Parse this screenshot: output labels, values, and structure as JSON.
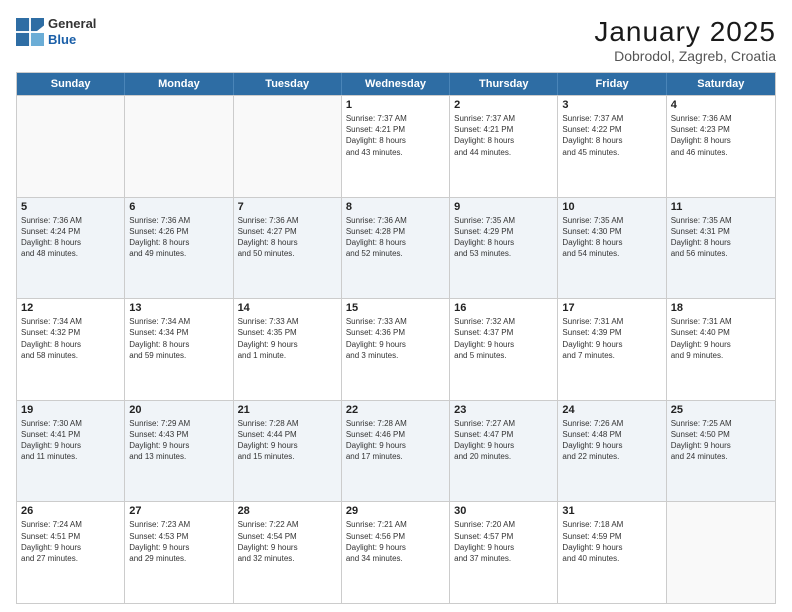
{
  "header": {
    "logo_general": "General",
    "logo_blue": "Blue",
    "title": "January 2025",
    "subtitle": "Dobrodol, Zagreb, Croatia"
  },
  "weekdays": [
    "Sunday",
    "Monday",
    "Tuesday",
    "Wednesday",
    "Thursday",
    "Friday",
    "Saturday"
  ],
  "weeks": [
    [
      {
        "day": "",
        "info": ""
      },
      {
        "day": "",
        "info": ""
      },
      {
        "day": "",
        "info": ""
      },
      {
        "day": "1",
        "info": "Sunrise: 7:37 AM\nSunset: 4:21 PM\nDaylight: 8 hours\nand 43 minutes."
      },
      {
        "day": "2",
        "info": "Sunrise: 7:37 AM\nSunset: 4:21 PM\nDaylight: 8 hours\nand 44 minutes."
      },
      {
        "day": "3",
        "info": "Sunrise: 7:37 AM\nSunset: 4:22 PM\nDaylight: 8 hours\nand 45 minutes."
      },
      {
        "day": "4",
        "info": "Sunrise: 7:36 AM\nSunset: 4:23 PM\nDaylight: 8 hours\nand 46 minutes."
      }
    ],
    [
      {
        "day": "5",
        "info": "Sunrise: 7:36 AM\nSunset: 4:24 PM\nDaylight: 8 hours\nand 48 minutes."
      },
      {
        "day": "6",
        "info": "Sunrise: 7:36 AM\nSunset: 4:26 PM\nDaylight: 8 hours\nand 49 minutes."
      },
      {
        "day": "7",
        "info": "Sunrise: 7:36 AM\nSunset: 4:27 PM\nDaylight: 8 hours\nand 50 minutes."
      },
      {
        "day": "8",
        "info": "Sunrise: 7:36 AM\nSunset: 4:28 PM\nDaylight: 8 hours\nand 52 minutes."
      },
      {
        "day": "9",
        "info": "Sunrise: 7:35 AM\nSunset: 4:29 PM\nDaylight: 8 hours\nand 53 minutes."
      },
      {
        "day": "10",
        "info": "Sunrise: 7:35 AM\nSunset: 4:30 PM\nDaylight: 8 hours\nand 54 minutes."
      },
      {
        "day": "11",
        "info": "Sunrise: 7:35 AM\nSunset: 4:31 PM\nDaylight: 8 hours\nand 56 minutes."
      }
    ],
    [
      {
        "day": "12",
        "info": "Sunrise: 7:34 AM\nSunset: 4:32 PM\nDaylight: 8 hours\nand 58 minutes."
      },
      {
        "day": "13",
        "info": "Sunrise: 7:34 AM\nSunset: 4:34 PM\nDaylight: 8 hours\nand 59 minutes."
      },
      {
        "day": "14",
        "info": "Sunrise: 7:33 AM\nSunset: 4:35 PM\nDaylight: 9 hours\nand 1 minute."
      },
      {
        "day": "15",
        "info": "Sunrise: 7:33 AM\nSunset: 4:36 PM\nDaylight: 9 hours\nand 3 minutes."
      },
      {
        "day": "16",
        "info": "Sunrise: 7:32 AM\nSunset: 4:37 PM\nDaylight: 9 hours\nand 5 minutes."
      },
      {
        "day": "17",
        "info": "Sunrise: 7:31 AM\nSunset: 4:39 PM\nDaylight: 9 hours\nand 7 minutes."
      },
      {
        "day": "18",
        "info": "Sunrise: 7:31 AM\nSunset: 4:40 PM\nDaylight: 9 hours\nand 9 minutes."
      }
    ],
    [
      {
        "day": "19",
        "info": "Sunrise: 7:30 AM\nSunset: 4:41 PM\nDaylight: 9 hours\nand 11 minutes."
      },
      {
        "day": "20",
        "info": "Sunrise: 7:29 AM\nSunset: 4:43 PM\nDaylight: 9 hours\nand 13 minutes."
      },
      {
        "day": "21",
        "info": "Sunrise: 7:28 AM\nSunset: 4:44 PM\nDaylight: 9 hours\nand 15 minutes."
      },
      {
        "day": "22",
        "info": "Sunrise: 7:28 AM\nSunset: 4:46 PM\nDaylight: 9 hours\nand 17 minutes."
      },
      {
        "day": "23",
        "info": "Sunrise: 7:27 AM\nSunset: 4:47 PM\nDaylight: 9 hours\nand 20 minutes."
      },
      {
        "day": "24",
        "info": "Sunrise: 7:26 AM\nSunset: 4:48 PM\nDaylight: 9 hours\nand 22 minutes."
      },
      {
        "day": "25",
        "info": "Sunrise: 7:25 AM\nSunset: 4:50 PM\nDaylight: 9 hours\nand 24 minutes."
      }
    ],
    [
      {
        "day": "26",
        "info": "Sunrise: 7:24 AM\nSunset: 4:51 PM\nDaylight: 9 hours\nand 27 minutes."
      },
      {
        "day": "27",
        "info": "Sunrise: 7:23 AM\nSunset: 4:53 PM\nDaylight: 9 hours\nand 29 minutes."
      },
      {
        "day": "28",
        "info": "Sunrise: 7:22 AM\nSunset: 4:54 PM\nDaylight: 9 hours\nand 32 minutes."
      },
      {
        "day": "29",
        "info": "Sunrise: 7:21 AM\nSunset: 4:56 PM\nDaylight: 9 hours\nand 34 minutes."
      },
      {
        "day": "30",
        "info": "Sunrise: 7:20 AM\nSunset: 4:57 PM\nDaylight: 9 hours\nand 37 minutes."
      },
      {
        "day": "31",
        "info": "Sunrise: 7:18 AM\nSunset: 4:59 PM\nDaylight: 9 hours\nand 40 minutes."
      },
      {
        "day": "",
        "info": ""
      }
    ]
  ]
}
